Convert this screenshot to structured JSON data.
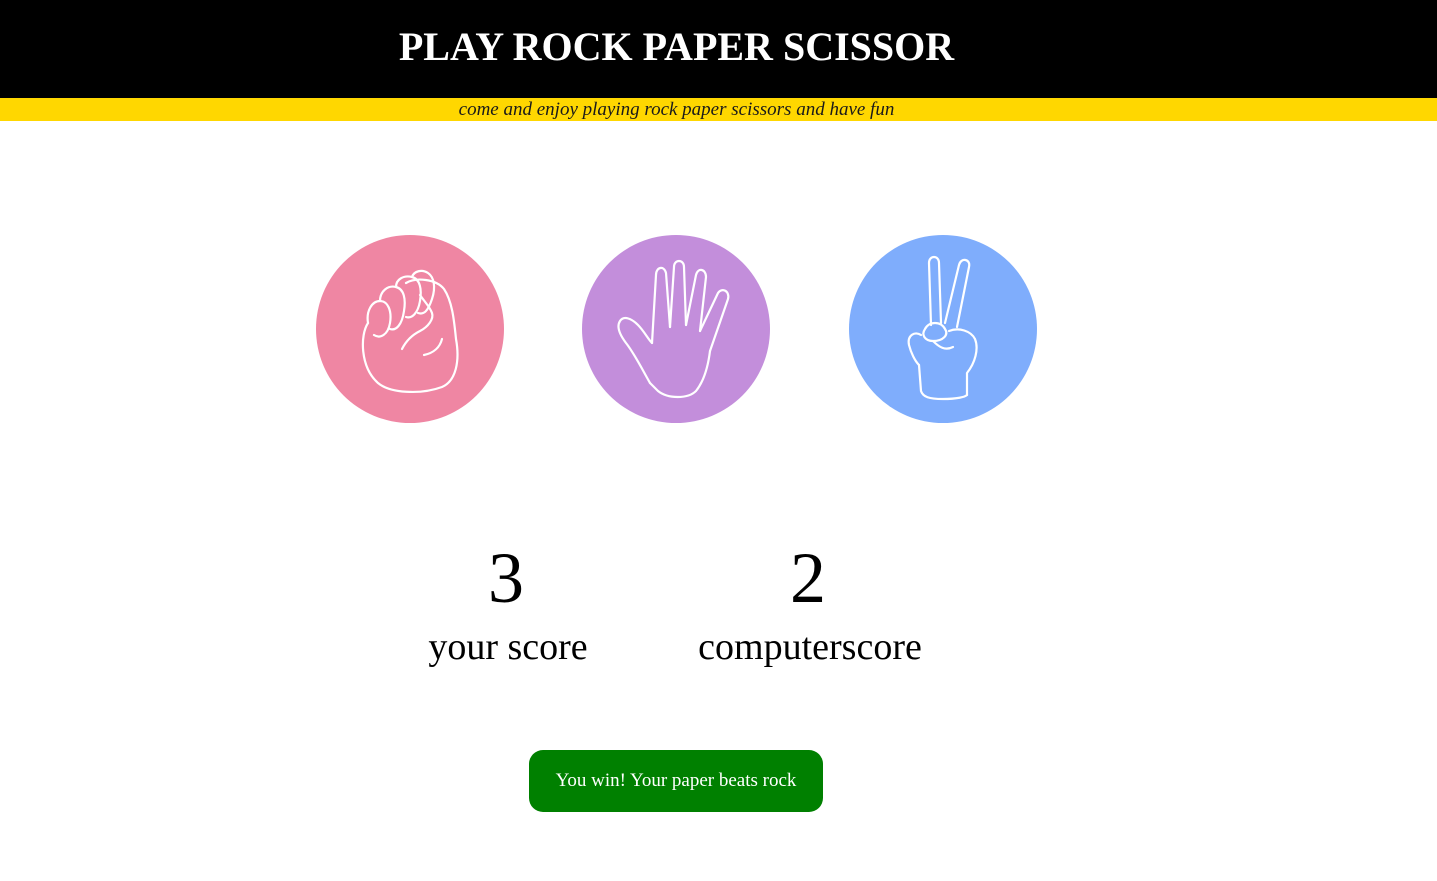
{
  "header": {
    "title": "PLAY ROCK PAPER SCISSOR",
    "tagline": "come and enjoy playing rock paper scissors and have fun"
  },
  "choices": [
    {
      "id": "rock",
      "icon": "fist-icon",
      "color": "#ef86a3"
    },
    {
      "id": "paper",
      "icon": "open-hand-icon",
      "color": "#c38edb"
    },
    {
      "id": "scissors",
      "icon": "peace-hand-icon",
      "color": "#7fadfc"
    }
  ],
  "scoreboard": {
    "user": {
      "value": "3",
      "label": "your score"
    },
    "computer": {
      "value": "2",
      "label": "computerscore"
    }
  },
  "result": {
    "message": "You win! Your paper beats rock",
    "color": "#008000"
  },
  "colors": {
    "header_bg": "#000000",
    "tagline_bg": "#ffd700",
    "page_bg": "#ffffff"
  }
}
